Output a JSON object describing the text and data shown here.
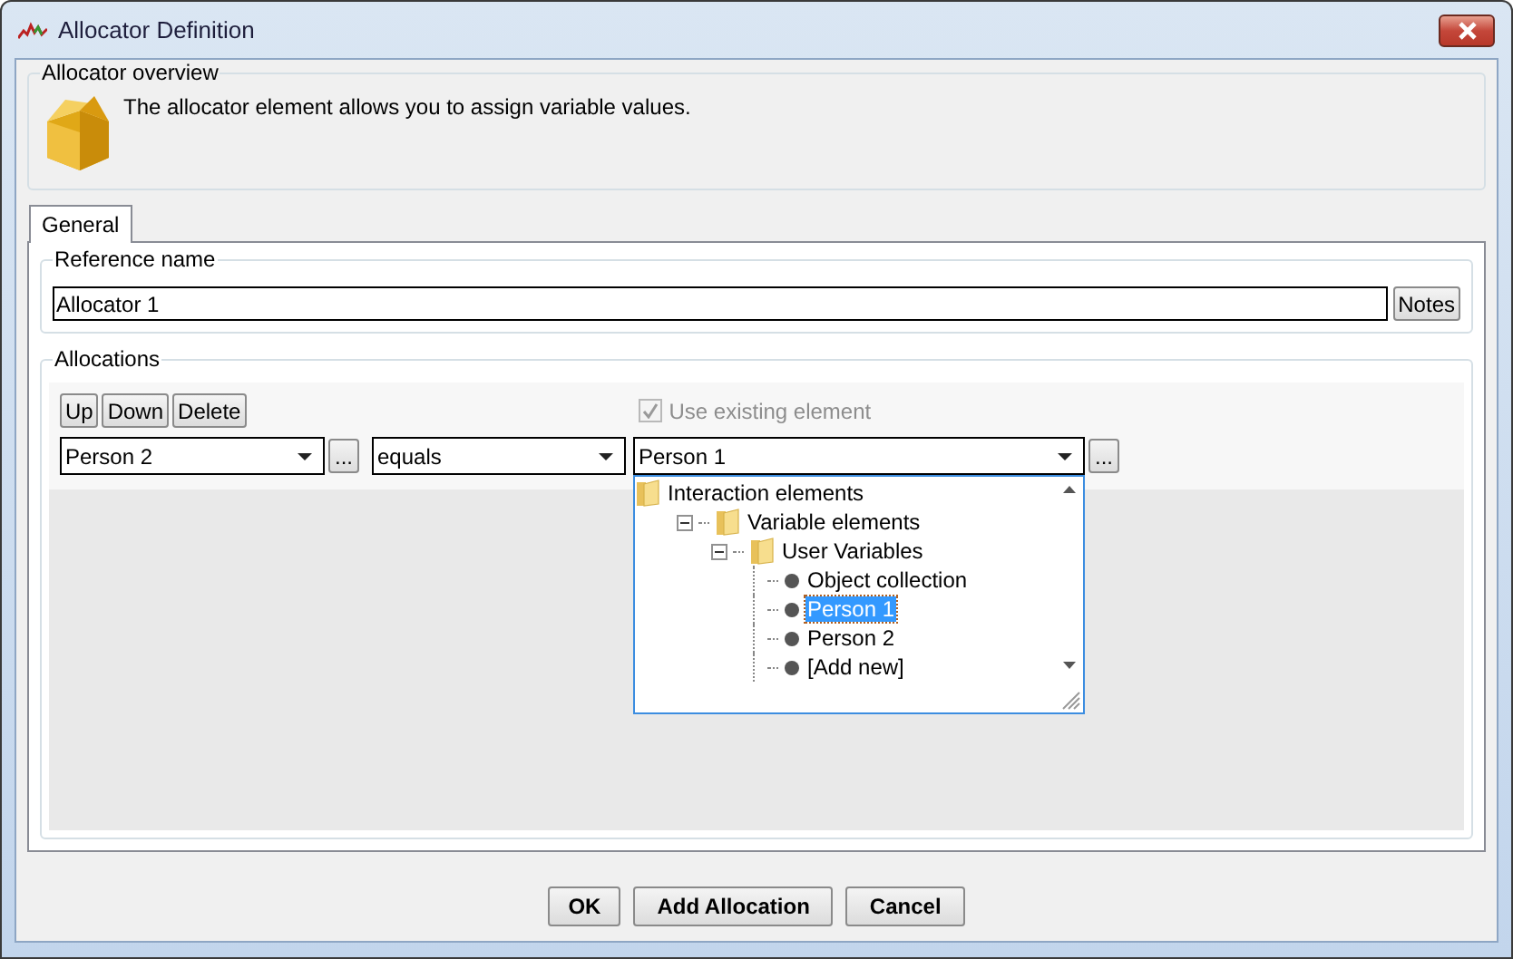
{
  "window": {
    "title": "Allocator Definition"
  },
  "overview": {
    "legend": "Allocator overview",
    "text": "The allocator element allows you to assign variable values."
  },
  "tabs": [
    {
      "label": "General",
      "selected": true
    }
  ],
  "reference": {
    "legend": "Reference name",
    "value": "Allocator 1",
    "notes_button": "Notes"
  },
  "allocations": {
    "legend": "Allocations",
    "buttons": [
      "Up",
      "Down",
      "Delete"
    ],
    "use_existing": {
      "label": "Use existing element",
      "checked": true,
      "disabled": true
    },
    "left_combo": {
      "value": "Person 2"
    },
    "left_more": "...",
    "operator_combo": {
      "value": "equals"
    },
    "right_combo": {
      "value": "Person 1",
      "open": true
    },
    "right_more": "...",
    "tree": [
      {
        "label": "Interaction elements",
        "kind": "folder",
        "selected": false,
        "children": [
          {
            "label": "Variable elements",
            "kind": "folder",
            "expanded": true,
            "selected": false,
            "children": [
              {
                "label": "User Variables",
                "kind": "folder",
                "expanded": true,
                "selected": false,
                "children": [
                  {
                    "label": "Object collection",
                    "kind": "leaf",
                    "selected": false
                  },
                  {
                    "label": "Person 1",
                    "kind": "leaf",
                    "selected": true
                  },
                  {
                    "label": "Person 2",
                    "kind": "leaf",
                    "selected": false
                  },
                  {
                    "label": "[Add new]",
                    "kind": "leaf",
                    "selected": false
                  }
                ]
              }
            ]
          }
        ]
      }
    ]
  },
  "footer_buttons": [
    "OK",
    "Add Allocation",
    "Cancel"
  ]
}
